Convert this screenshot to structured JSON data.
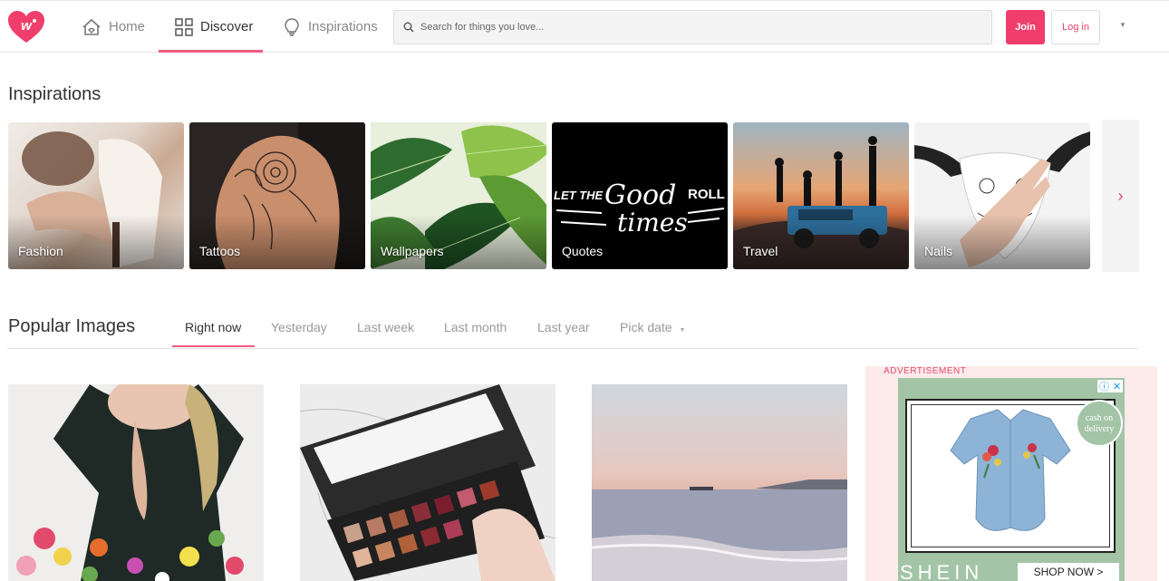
{
  "header": {
    "nav": [
      {
        "label": "Home",
        "icon": "home-icon"
      },
      {
        "label": "Discover",
        "icon": "grid-icon"
      },
      {
        "label": "Inspirations",
        "icon": "lightbulb-icon"
      }
    ],
    "search_placeholder": "Search for things you love...",
    "join_label": "Join",
    "login_label": "Log in",
    "accent_color": "#ef3e6c"
  },
  "inspirations": {
    "title": "Inspirations",
    "cards": [
      {
        "label": "Fashion"
      },
      {
        "label": "Tattoos"
      },
      {
        "label": "Wallpapers"
      },
      {
        "label": "Quotes",
        "overlay": "LET THE Good times ROLL"
      },
      {
        "label": "Travel"
      },
      {
        "label": "Nails"
      }
    ],
    "next_arrow": "›"
  },
  "popular": {
    "title": "Popular Images",
    "tabs": [
      "Right now",
      "Yesterday",
      "Last week",
      "Last month",
      "Last year",
      "Pick date"
    ],
    "active_tab": "Right now"
  },
  "ad": {
    "label": "ADVERTISEMENT",
    "badge": "cash on delivery",
    "brand": "SHEIN",
    "cta": "SHOP NOW >"
  }
}
